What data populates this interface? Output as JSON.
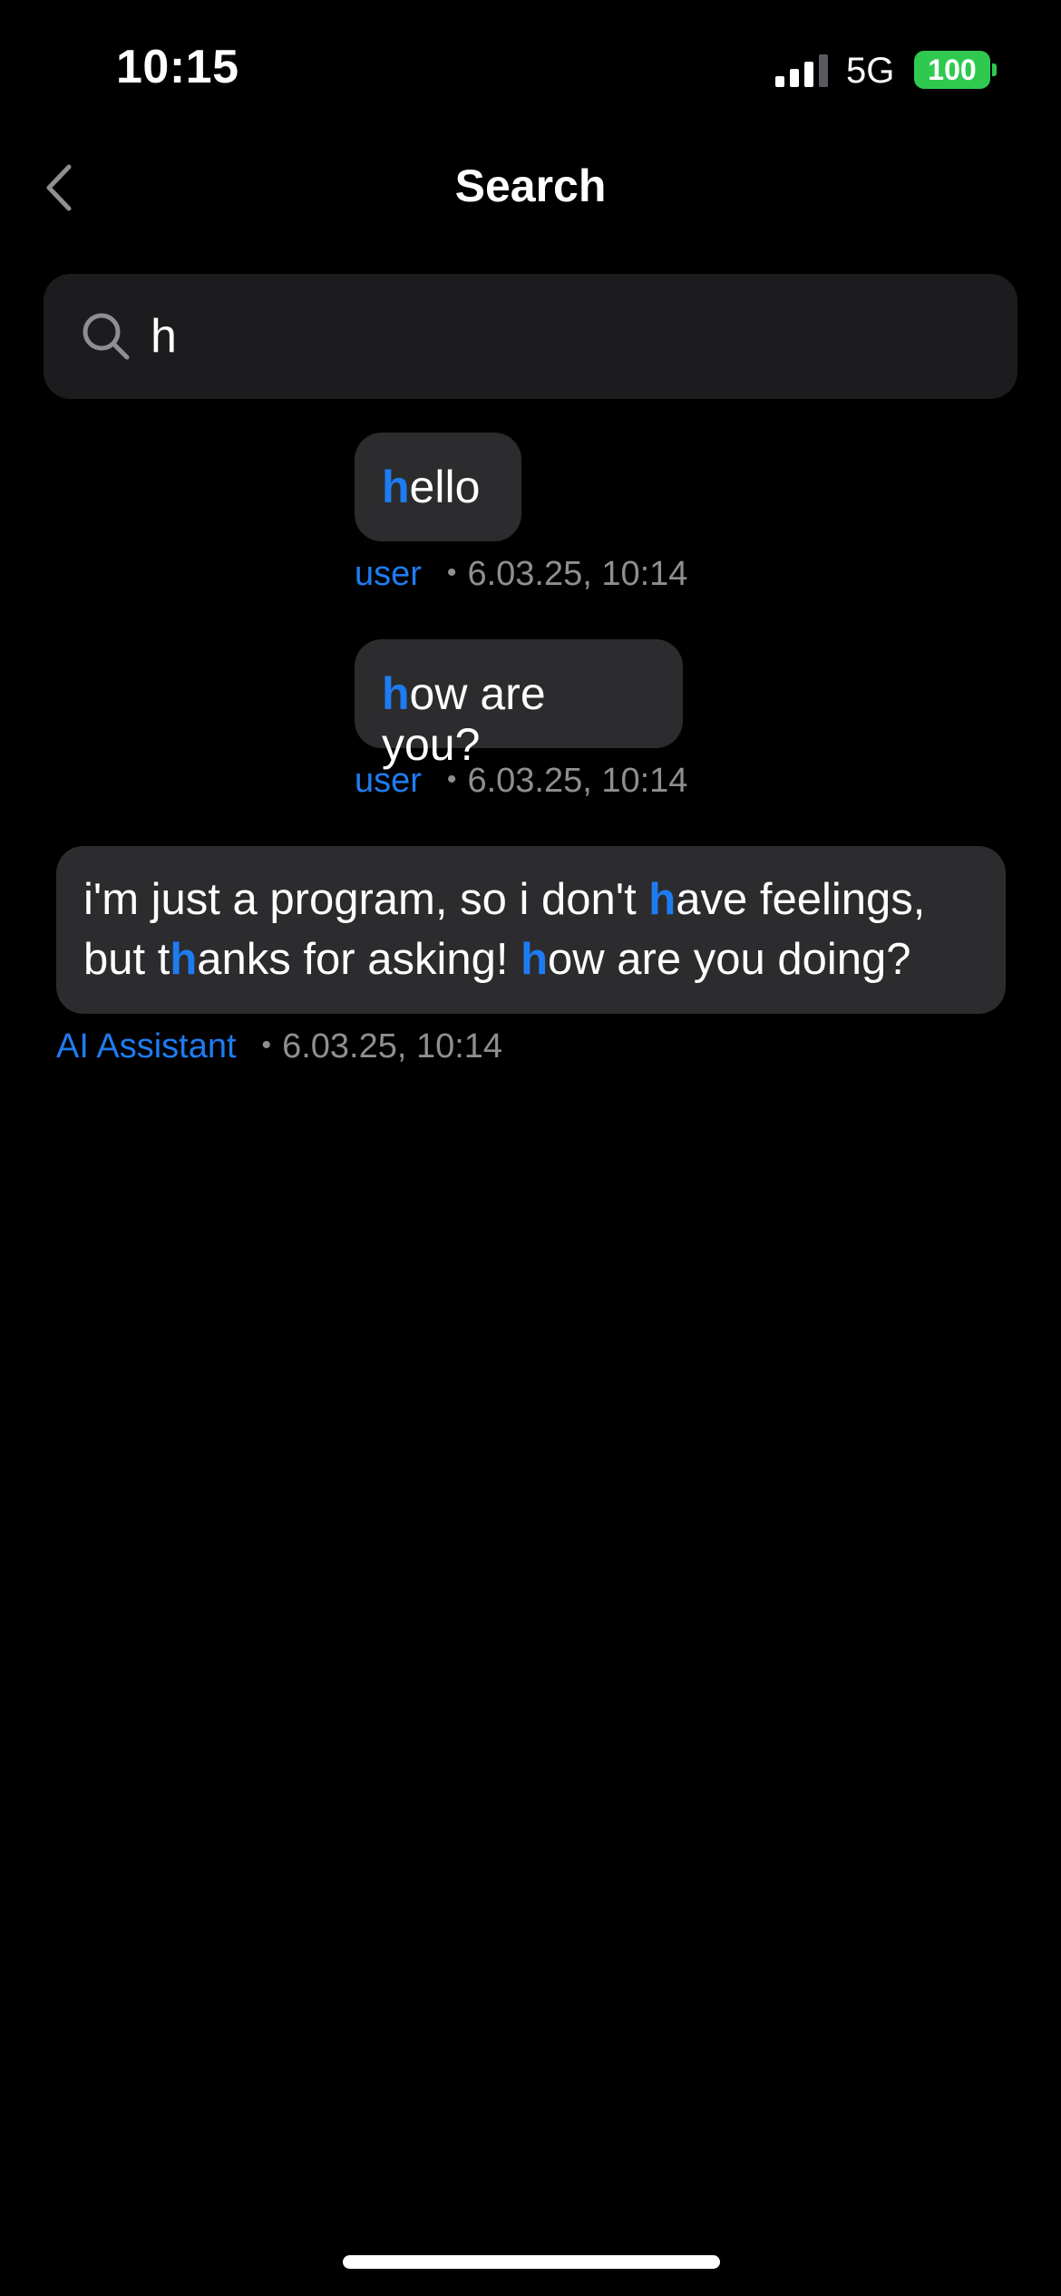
{
  "status_bar": {
    "time": "10:15",
    "network": "5G",
    "battery": "100",
    "signal_icon": "cellular-signal-icon",
    "battery_color": "#30c94f"
  },
  "nav": {
    "back_icon": "chevron-left-icon",
    "title": "Search"
  },
  "search": {
    "icon": "magnifying-glass-icon",
    "value": "h",
    "highlight_color": "#1e7cf2"
  },
  "results": [
    {
      "segments": [
        {
          "text": "h",
          "highlight": true
        },
        {
          "text": "ello",
          "highlight": false
        }
      ],
      "author": "user",
      "timestamp": "6.03.25, 10:14"
    },
    {
      "segments": [
        {
          "text": "h",
          "highlight": true
        },
        {
          "text": "ow are you?",
          "highlight": false
        }
      ],
      "author": "user",
      "timestamp": "6.03.25, 10:14"
    },
    {
      "segments": [
        {
          "text": "i'm just a program, so i don't ",
          "highlight": false
        },
        {
          "text": "h",
          "highlight": true
        },
        {
          "text": "ave feelings, but t",
          "highlight": false
        },
        {
          "text": "h",
          "highlight": true
        },
        {
          "text": "anks for asking! ",
          "highlight": false
        },
        {
          "text": "h",
          "highlight": true
        },
        {
          "text": "ow are you doing?",
          "highlight": false
        }
      ],
      "author": "AI Assistant",
      "timestamp": "6.03.25, 10:14"
    }
  ]
}
